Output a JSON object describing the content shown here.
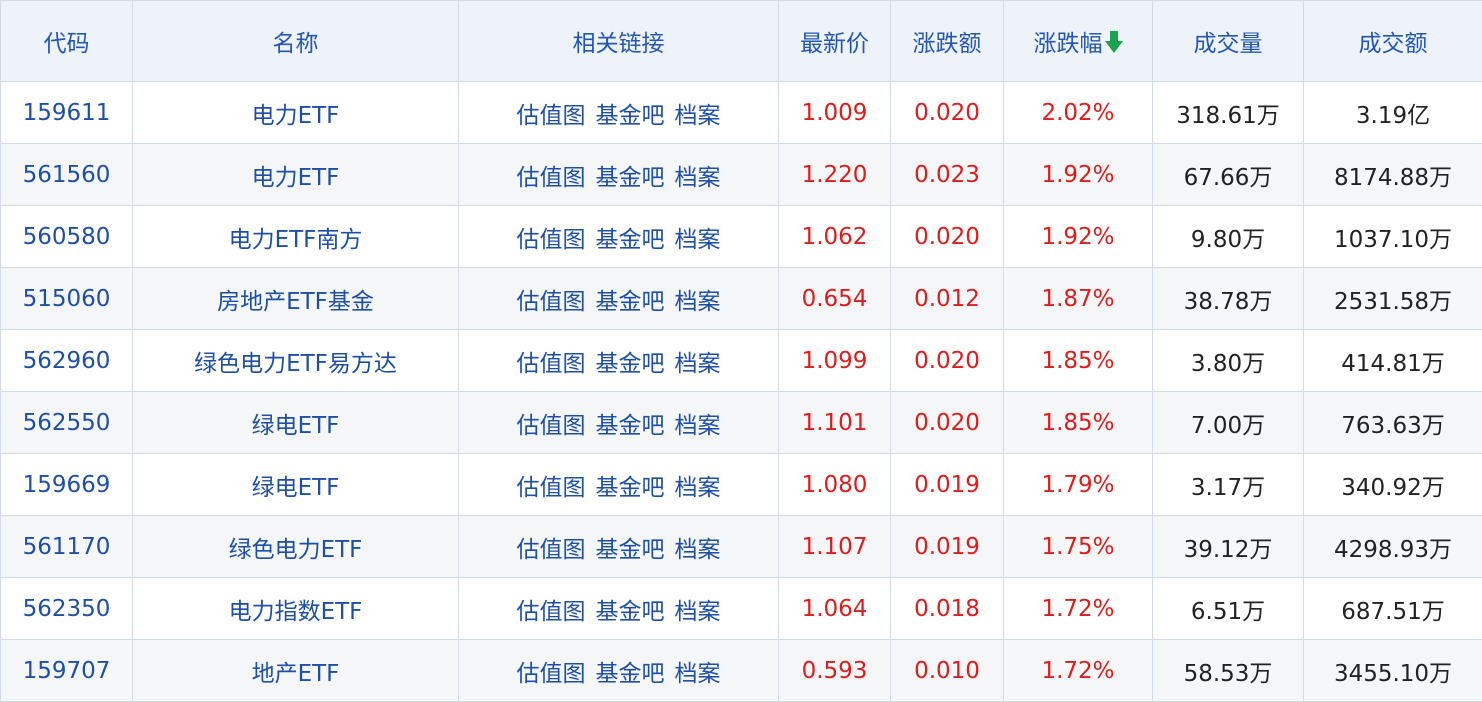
{
  "headers": [
    "代码",
    "名称",
    "相关链接",
    "最新价",
    "涨跌额",
    "涨跌幅",
    "成交量",
    "成交额"
  ],
  "colors": {
    "header_bg": "#eef3fa",
    "header_text": "#2457b5",
    "up": "#e01b1b",
    "sort_arrow": "#1aa34a"
  },
  "sort_icon": "arrow-down-icon",
  "rows": [
    {
      "code": "159611",
      "name": "电力ETF",
      "links": [
        "估值图",
        "基金吧",
        "档案"
      ],
      "price": "1.009",
      "change": "0.020",
      "pct": "2.02%",
      "volume": "318.61万",
      "amount": "3.19亿"
    },
    {
      "code": "561560",
      "name": "电力ETF",
      "links": [
        "估值图",
        "基金吧",
        "档案"
      ],
      "price": "1.220",
      "change": "0.023",
      "pct": "1.92%",
      "volume": "67.66万",
      "amount": "8174.88万"
    },
    {
      "code": "560580",
      "name": "电力ETF南方",
      "links": [
        "估值图",
        "基金吧",
        "档案"
      ],
      "price": "1.062",
      "change": "0.020",
      "pct": "1.92%",
      "volume": "9.80万",
      "amount": "1037.10万"
    },
    {
      "code": "515060",
      "name": "房地产ETF基金",
      "links": [
        "估值图",
        "基金吧",
        "档案"
      ],
      "price": "0.654",
      "change": "0.012",
      "pct": "1.87%",
      "volume": "38.78万",
      "amount": "2531.58万"
    },
    {
      "code": "562960",
      "name": "绿色电力ETF易方达",
      "links": [
        "估值图",
        "基金吧",
        "档案"
      ],
      "price": "1.099",
      "change": "0.020",
      "pct": "1.85%",
      "volume": "3.80万",
      "amount": "414.81万"
    },
    {
      "code": "562550",
      "name": "绿电ETF",
      "links": [
        "估值图",
        "基金吧",
        "档案"
      ],
      "price": "1.101",
      "change": "0.020",
      "pct": "1.85%",
      "volume": "7.00万",
      "amount": "763.63万"
    },
    {
      "code": "159669",
      "name": "绿电ETF",
      "links": [
        "估值图",
        "基金吧",
        "档案"
      ],
      "price": "1.080",
      "change": "0.019",
      "pct": "1.79%",
      "volume": "3.17万",
      "amount": "340.92万"
    },
    {
      "code": "561170",
      "name": "绿色电力ETF",
      "links": [
        "估值图",
        "基金吧",
        "档案"
      ],
      "price": "1.107",
      "change": "0.019",
      "pct": "1.75%",
      "volume": "39.12万",
      "amount": "4298.93万"
    },
    {
      "code": "562350",
      "name": "电力指数ETF",
      "links": [
        "估值图",
        "基金吧",
        "档案"
      ],
      "price": "1.064",
      "change": "0.018",
      "pct": "1.72%",
      "volume": "6.51万",
      "amount": "687.51万"
    },
    {
      "code": "159707",
      "name": "地产ETF",
      "links": [
        "估值图",
        "基金吧",
        "档案"
      ],
      "price": "0.593",
      "change": "0.010",
      "pct": "1.72%",
      "volume": "58.53万",
      "amount": "3455.10万"
    }
  ]
}
